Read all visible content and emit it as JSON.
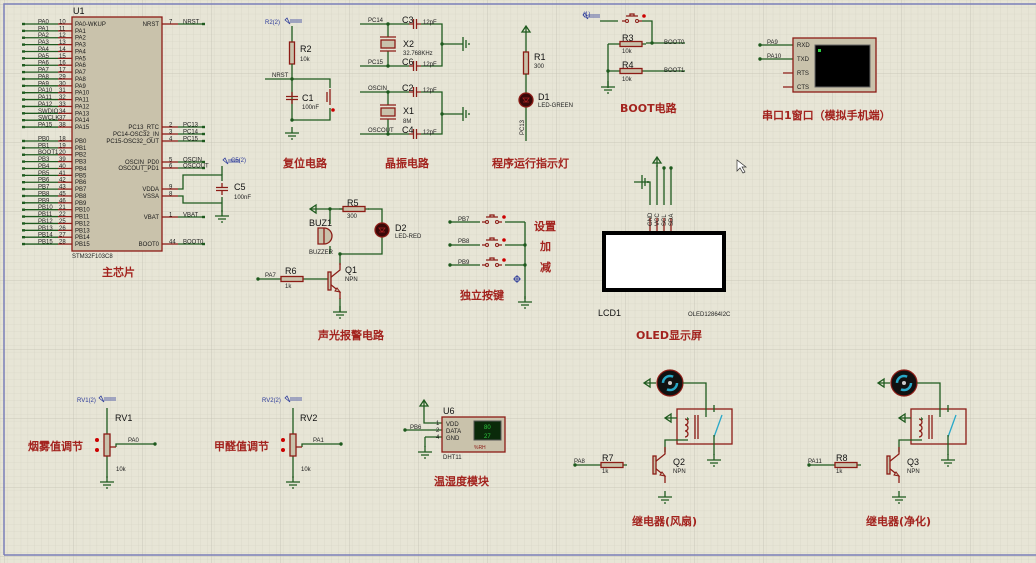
{
  "mcu": {
    "ref": "U1",
    "part": "STM32F103C8",
    "title": "主芯片",
    "left_pins": [
      {
        "net": "PA0",
        "num": "10",
        "name": "PA0-WKUP"
      },
      {
        "net": "PA1",
        "num": "11",
        "name": "PA1"
      },
      {
        "net": "PA2",
        "num": "12",
        "name": "PA2"
      },
      {
        "net": "PA3",
        "num": "13",
        "name": "PA3"
      },
      {
        "net": "PA4",
        "num": "14",
        "name": "PA4"
      },
      {
        "net": "PA5",
        "num": "15",
        "name": "PA5"
      },
      {
        "net": "PA6",
        "num": "16",
        "name": "PA6"
      },
      {
        "net": "PA7",
        "num": "17",
        "name": "PA7"
      },
      {
        "net": "PA8",
        "num": "29",
        "name": "PA8"
      },
      {
        "net": "PA9",
        "num": "30",
        "name": "PA9"
      },
      {
        "net": "PA10",
        "num": "31",
        "name": "PA10"
      },
      {
        "net": "PA11",
        "num": "32",
        "name": "PA11"
      },
      {
        "net": "PA12",
        "num": "33",
        "name": "PA12"
      },
      {
        "net": "SWDIO",
        "num": "34",
        "name": "PA13"
      },
      {
        "net": "SWCLK",
        "num": "37",
        "name": "PA14"
      },
      {
        "net": "PA15",
        "num": "38",
        "name": "PA15"
      },
      {
        "net": "PB0",
        "num": "18",
        "name": "PB0"
      },
      {
        "net": "PB1",
        "num": "19",
        "name": "PB1"
      },
      {
        "net": "BOOT1",
        "num": "20",
        "name": "PB2"
      },
      {
        "net": "PB3",
        "num": "39",
        "name": "PB3"
      },
      {
        "net": "PB4",
        "num": "40",
        "name": "PB4"
      },
      {
        "net": "PB5",
        "num": "41",
        "name": "PB5"
      },
      {
        "net": "PB6",
        "num": "42",
        "name": "PB6"
      },
      {
        "net": "PB7",
        "num": "43",
        "name": "PB7"
      },
      {
        "net": "PB8",
        "num": "45",
        "name": "PB8"
      },
      {
        "net": "PB9",
        "num": "46",
        "name": "PB9"
      },
      {
        "net": "PB10",
        "num": "21",
        "name": "PB10"
      },
      {
        "net": "PB11",
        "num": "22",
        "name": "PB11"
      },
      {
        "net": "PB12",
        "num": "25",
        "name": "PB12"
      },
      {
        "net": "PB13",
        "num": "26",
        "name": "PB13"
      },
      {
        "net": "PB14",
        "num": "27",
        "name": "PB14"
      },
      {
        "net": "PB15",
        "num": "28",
        "name": "PB15"
      }
    ],
    "right_pins": [
      {
        "net": "NRST",
        "num": "7",
        "name": "NRST"
      },
      {
        "net": "PC13",
        "num": "2",
        "name": "PC13_RTC"
      },
      {
        "net": "PC14",
        "num": "3",
        "name": "PC14-OSC32_IN"
      },
      {
        "net": "PC15",
        "num": "4",
        "name": "PC15-OSC32_OUT"
      },
      {
        "net": "OSCIN",
        "num": "5",
        "name": "OSCIN_PD0"
      },
      {
        "net": "OSCOUT",
        "num": "6",
        "name": "OSCOUT_PD1"
      },
      {
        "net": "",
        "num": "9",
        "name": "VDDA"
      },
      {
        "net": "",
        "num": "8",
        "name": "VSSA"
      },
      {
        "net": "VBAT",
        "num": "1",
        "name": "VBAT"
      },
      {
        "net": "BOOT0",
        "num": "44",
        "name": "BOOT0"
      }
    ],
    "c5": {
      "ref": "C5",
      "value": "100nF",
      "terminal": "C5(2)"
    }
  },
  "reset": {
    "title": "复位电路",
    "terminal": "R2(2)",
    "r_ref": "R2",
    "r_val": "10k",
    "net": "NRST",
    "c_ref": "C1",
    "c_val": "100nF"
  },
  "crystal": {
    "title": "晶振电路",
    "nets": [
      "PC14",
      "PC15",
      "OSCIN",
      "OSCOUT"
    ],
    "caps": [
      {
        "ref": "C3",
        "val": "12pF"
      },
      {
        "ref": "C6",
        "val": "12pF"
      },
      {
        "ref": "C2",
        "val": "12pF"
      },
      {
        "ref": "C4",
        "val": "12pF"
      }
    ],
    "x2": {
      "ref": "X2",
      "val": "32.768KHz"
    },
    "x1": {
      "ref": "X1",
      "val": "8M"
    }
  },
  "led": {
    "title": "程序运行指示灯",
    "r_ref": "R1",
    "r_val": "300",
    "d_ref": "D1",
    "d_val": "LED-GREEN",
    "net": "PC13"
  },
  "boot": {
    "title": "BOOT电路",
    "terminal": "(1)",
    "r3": "R3",
    "r3_val": "10k",
    "r4": "R4",
    "r4_val": "10k",
    "net0": "BOOT0",
    "net1": "BOOT1"
  },
  "uart": {
    "title": "串口1窗口（模拟手机端）",
    "pins": [
      "RXD",
      "TXD",
      "RTS",
      "CTS"
    ],
    "nets": [
      "PA9",
      "PA10"
    ]
  },
  "oled": {
    "title": "OLED显示屏",
    "ref": "LCD1",
    "part": "OLED12864I2C",
    "pins": [
      "GND",
      "VCC",
      "SCL",
      "SDA"
    ]
  },
  "alarm": {
    "title": "声光报警电路",
    "r5": "R5",
    "r5_val": "300",
    "buz": "BUZ1",
    "buz_val": "BUZZER",
    "d2": "D2",
    "d2_val": "LED-RED",
    "q": "Q1",
    "q_val": "NPN",
    "r6": "R6",
    "r6_val": "1k",
    "net": "PA7"
  },
  "keys": {
    "title": "独立按键",
    "nets": [
      "PB7",
      "PB8",
      "PB9"
    ],
    "labels": [
      "设置",
      "加",
      "减"
    ]
  },
  "rv1": {
    "title": "烟雾值调节",
    "terminal": "RV1(2)",
    "ref": "RV1",
    "val": "10k",
    "net": "PA0"
  },
  "rv2": {
    "title": "甲醛值调节",
    "terminal": "RV2(2)",
    "ref": "RV2",
    "val": "10k",
    "net": "PA1"
  },
  "dht": {
    "title": "温湿度模块",
    "ref": "U6",
    "part": "DHT11",
    "net": "PB6",
    "pins": [
      {
        "num": "1",
        "name": "VDD"
      },
      {
        "num": "2",
        "name": "DATA"
      },
      {
        "num": "4",
        "name": "GND"
      }
    ],
    "reading1": "80",
    "reading2": "27",
    "unit": "%RH"
  },
  "relay1": {
    "title": "继电器(风扇)",
    "r": "R7",
    "r_val": "1k",
    "q": "Q2",
    "q_val": "NPN",
    "net": "PA8"
  },
  "relay2": {
    "title": "继电器(净化)",
    "r": "R8",
    "r_val": "1k",
    "q": "Q3",
    "q_val": "NPN",
    "net": "PA11"
  },
  "colors": {
    "background": "#e7e5d6",
    "wire": "#1e5a1e",
    "component": "#8c1c16",
    "title": "#a3231e",
    "terminal": "#2b3a9a"
  }
}
